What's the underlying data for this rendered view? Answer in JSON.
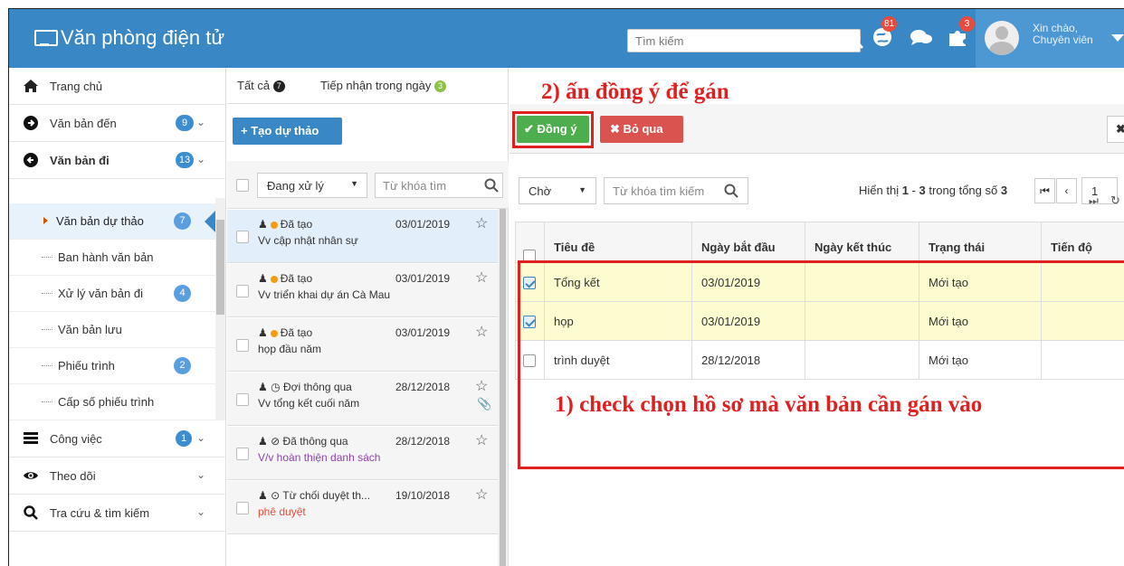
{
  "header": {
    "app_title": "Văn phòng điện tử",
    "search_placeholder": "Tìm kiếm",
    "notification_count": "81",
    "puzzle_count": "3",
    "greeting_line1": "Xin chào,",
    "greeting_line2": "Chuyên viên"
  },
  "sidebar": {
    "home": "Trang chủ",
    "incoming": {
      "label": "Văn bản đến",
      "badge": "9"
    },
    "outgoing": {
      "label": "Văn bản đi",
      "badge": "13"
    },
    "sub": [
      {
        "label": "Văn bản dự thảo",
        "badge": "7"
      },
      {
        "label": "Ban hành văn bản",
        "badge": ""
      },
      {
        "label": "Xử lý văn bản đi",
        "badge": "4"
      },
      {
        "label": "Văn bản lưu",
        "badge": ""
      },
      {
        "label": "Phiếu trình",
        "badge": "2"
      },
      {
        "label": "Cấp số phiếu trình",
        "badge": ""
      }
    ],
    "tasks": {
      "label": "Công việc",
      "badge": "1"
    },
    "follow": {
      "label": "Theo dõi"
    },
    "lookup": {
      "label": "Tra cứu & tìm kiếm"
    }
  },
  "middle": {
    "tab_all": "Tất cả",
    "tab_all_count": "7",
    "tab_today": "Tiếp nhận trong ngày",
    "tab_today_count": "3",
    "create_button": "+ Tạo dự thảo",
    "status_select": "Đang xử lý",
    "keyword_placeholder": "Từ khóa tìm",
    "items": [
      {
        "status": "Đã tạo",
        "date": "03/01/2019",
        "title": "Vv cập nhật nhân sự"
      },
      {
        "status": "Đã tạo",
        "date": "03/01/2019",
        "title": "Vv triển khai dự án Cà Mau"
      },
      {
        "status": "Đã tạo",
        "date": "03/01/2019",
        "title": "họp đầu năm"
      },
      {
        "status": "Đợi thông qua",
        "date": "28/12/2018",
        "title": "Vv tổng kết cuối năm"
      },
      {
        "status": "Đã thông qua",
        "date": "28/12/2018",
        "title": "V/v hoàn thiện danh sách"
      },
      {
        "status": "Từ chối duyệt th...",
        "date": "19/10/2018",
        "title": "phê duyệt"
      }
    ]
  },
  "right": {
    "agree_button": "Đồng ý",
    "skip_button": "Bỏ qua",
    "filter_select": "Chờ",
    "keyword_placeholder": "Từ khóa tìm kiếm",
    "paging_prefix": "Hiển thị ",
    "paging_from": "1",
    "paging_sep": " - ",
    "paging_to": "3",
    "paging_mid": " trong tổng số ",
    "paging_total": "3",
    "page_number": "1",
    "columns": [
      "Tiêu đề",
      "Ngày bắt đầu",
      "Ngày kết thúc",
      "Trạng thái",
      "Tiến độ"
    ],
    "rows": [
      {
        "title": "Tổng kết",
        "start": "03/01/2019",
        "end": "",
        "status": "Mới tạo",
        "progress": "",
        "checked": true
      },
      {
        "title": "họp",
        "start": "03/01/2019",
        "end": "",
        "status": "Mới tạo",
        "progress": "",
        "checked": true
      },
      {
        "title": "trình duyệt",
        "start": "28/12/2018",
        "end": "",
        "status": "Mới tạo",
        "progress": "",
        "checked": false
      }
    ]
  },
  "annotations": {
    "step2": "2) ấn đồng ý để gán",
    "step1": "1) check chọn hồ sơ mà văn bản cần gán vào"
  }
}
